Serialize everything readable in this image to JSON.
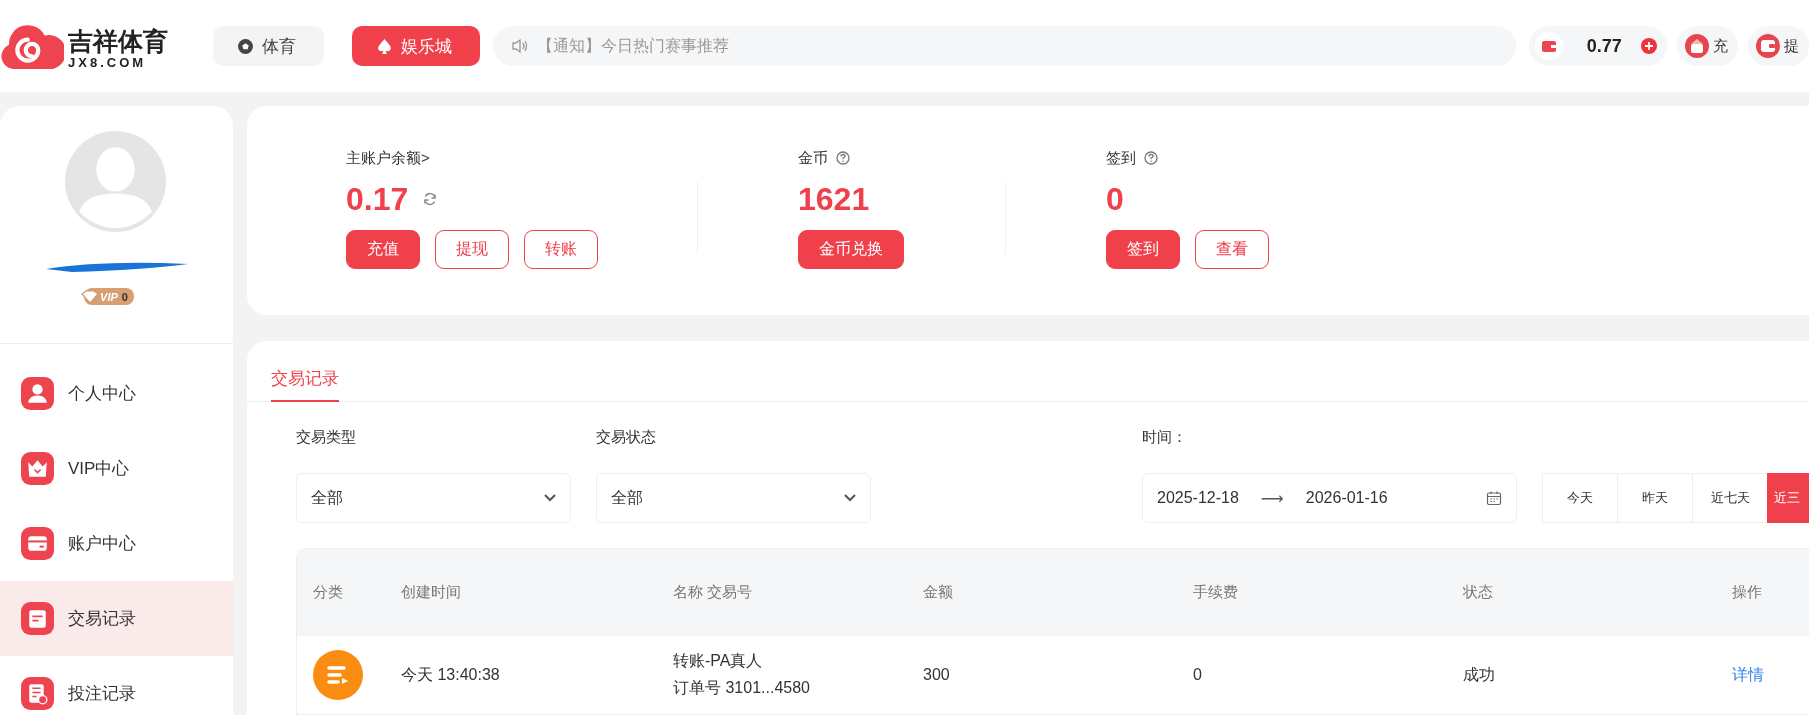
{
  "header": {
    "logo": {
      "name": "吉祥体育",
      "domain": "JX8.COM"
    },
    "nav": [
      {
        "label": "体育",
        "kind": "ball",
        "selected": false
      },
      {
        "label": "娱乐城",
        "kind": "spade",
        "selected": true
      }
    ],
    "notice": "【通知】今日热门赛事推荐",
    "balance": "0.77",
    "shortcuts": [
      {
        "label": "充",
        "kind": "deposit"
      },
      {
        "label": "提",
        "kind": "wallet"
      }
    ]
  },
  "sidebar": {
    "vip": {
      "label": "VIP",
      "level": "0"
    },
    "items": [
      {
        "label": "个人中心",
        "kind": "user",
        "selected": false
      },
      {
        "label": "VIP中心",
        "kind": "crown",
        "selected": false
      },
      {
        "label": "账户中心",
        "kind": "card",
        "selected": false
      },
      {
        "label": "交易记录",
        "kind": "notepad",
        "selected": true
      },
      {
        "label": "投注记录",
        "kind": "betlist",
        "selected": false
      }
    ]
  },
  "wallet": [
    {
      "label": "主账户余额>",
      "value": "0.17",
      "kind": "refresh",
      "buttons": [
        {
          "label": "充值",
          "primary": true
        },
        {
          "label": "提现",
          "primary": false
        },
        {
          "label": "转账",
          "primary": false
        }
      ]
    },
    {
      "label": "金币",
      "value": "1621",
      "kind": "help",
      "buttons": [
        {
          "label": "金币兑换",
          "primary": true
        }
      ]
    },
    {
      "label": "签到",
      "value": "0",
      "kind": "help",
      "buttons": [
        {
          "label": "签到",
          "primary": true
        },
        {
          "label": "查看",
          "primary": false
        }
      ]
    }
  ],
  "records": {
    "tab": "交易记录",
    "filters": [
      {
        "label": "交易类型",
        "value": "全部"
      },
      {
        "label": "交易状态",
        "value": "全部"
      }
    ],
    "time": {
      "label": "时间：",
      "start": "2025-12-18",
      "arrow": "⟶",
      "end": "2026-01-16"
    },
    "ranges": [
      {
        "label": "今天",
        "selected": false
      },
      {
        "label": "昨天",
        "selected": false
      },
      {
        "label": "近七天",
        "selected": false
      },
      {
        "label": "近三",
        "selected": true
      }
    ],
    "table": {
      "columns": [
        "分类",
        "创建时间",
        "名称 交易号",
        "金额",
        "手续费",
        "状态",
        "操作"
      ],
      "rows": [
        {
          "created": "今天 13:40:38",
          "name": "转账-PA真人",
          "order": "订单号 3101...4580",
          "amount": "300",
          "fee": "0",
          "status": "成功",
          "action": "详情"
        }
      ]
    }
  }
}
